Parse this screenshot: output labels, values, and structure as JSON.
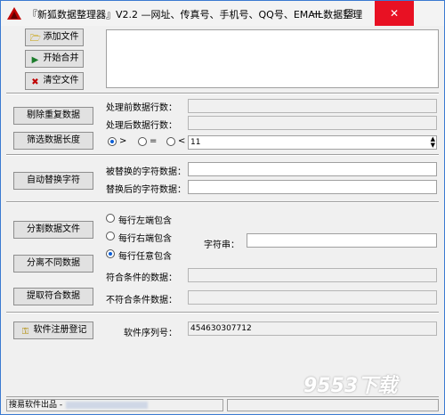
{
  "window": {
    "title": "『新狐数据整理器』V2.2 —网址、传真号、手机号、QQ号、EMAIL数据整理",
    "min_label": "—",
    "max_label": "☐",
    "close_label": "✕"
  },
  "file_panel": {
    "add_file_label": "添加文件",
    "merge_label": "开始合并",
    "clear_label": "清空文件"
  },
  "dedup": {
    "button_label": "剔除重复数据",
    "before_label": "处理前数据行数：",
    "after_label": "处理后数据行数："
  },
  "length_filter": {
    "button_label": "筛选数据长度",
    "options": [
      ">",
      "=",
      "<"
    ],
    "selected": ">",
    "value": "11"
  },
  "replace": {
    "button_label": "自动替换字符",
    "target_label": "被替换的字符数据：",
    "replacement_label": "替换后的字符数据："
  },
  "split": {
    "split_button": "分割数据文件",
    "separate_button": "分离不同数据",
    "extract_button": "提取符合数据",
    "options": [
      "每行左端包含",
      "每行右端包含",
      "每行任意包含"
    ],
    "selected": "每行任意包含",
    "string_label": "字符串：",
    "match_label": "符合条件的数据：",
    "nomatch_label": "不符合条件数据："
  },
  "register": {
    "button_label": "软件注册登记",
    "serial_label": "软件序列号：",
    "serial_value": "454630307712"
  },
  "statusbar": {
    "text": "搜易软件出品 -"
  },
  "watermark": "9553下载",
  "colors": {
    "close_button": "#e81123",
    "radio_selected": "#0a5ed7"
  }
}
